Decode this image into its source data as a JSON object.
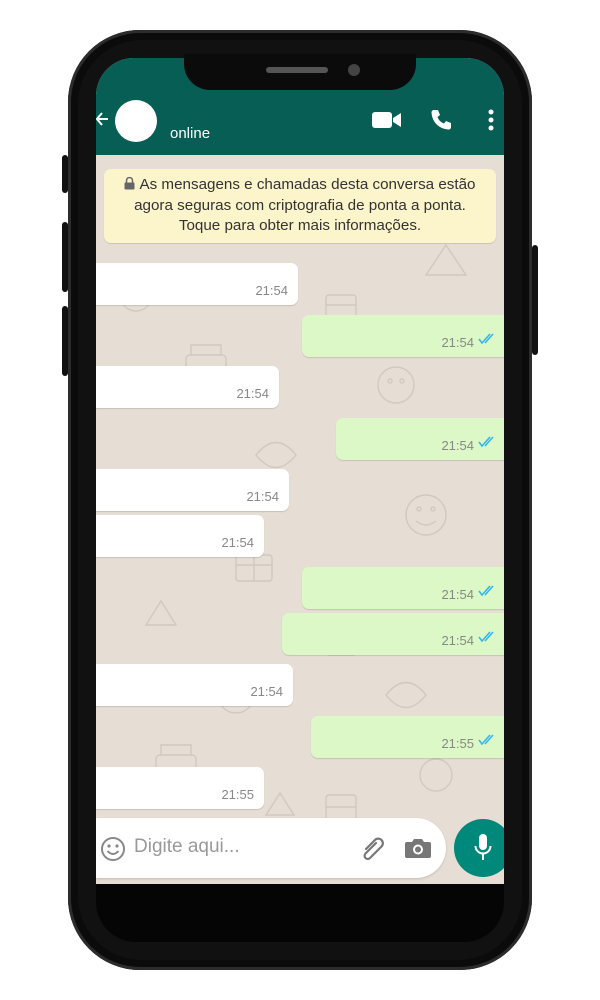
{
  "header": {
    "status": "online",
    "icons": [
      "arrow-back-icon",
      "video-call-icon",
      "phone-icon",
      "more-vert-icon"
    ],
    "color": "#075e54"
  },
  "notice": {
    "text": "As mensagens e chamadas desta conversa estão agora seguras com criptografia de ponta a ponta. Toque para obter mais informações."
  },
  "messages": [
    {
      "direction": "incoming",
      "time": "21:54"
    },
    {
      "direction": "outgoing",
      "time": "21:54",
      "status": "read"
    },
    {
      "direction": "incoming",
      "time": "21:54"
    },
    {
      "direction": "outgoing",
      "time": "21:54",
      "status": "read"
    },
    {
      "direction": "incoming",
      "time": "21:54"
    },
    {
      "direction": "incoming",
      "time": "21:54"
    },
    {
      "direction": "outgoing",
      "time": "21:54",
      "status": "read"
    },
    {
      "direction": "outgoing",
      "time": "21:54",
      "status": "read"
    },
    {
      "direction": "incoming",
      "time": "21:54"
    },
    {
      "direction": "outgoing",
      "time": "21:55",
      "status": "read"
    },
    {
      "direction": "incoming",
      "time": "21:55"
    }
  ],
  "composer": {
    "placeholder": "Digite aqui...",
    "icons": [
      "emoji-icon",
      "attach-icon",
      "camera-icon",
      "mic-icon"
    ]
  },
  "colors": {
    "outgoing_bubble": "#dcf8c6",
    "incoming_bubble": "#ffffff",
    "notice_bg": "#fcf4cb",
    "read_ticks": "#34b7f1",
    "mic_button": "#00897b"
  }
}
